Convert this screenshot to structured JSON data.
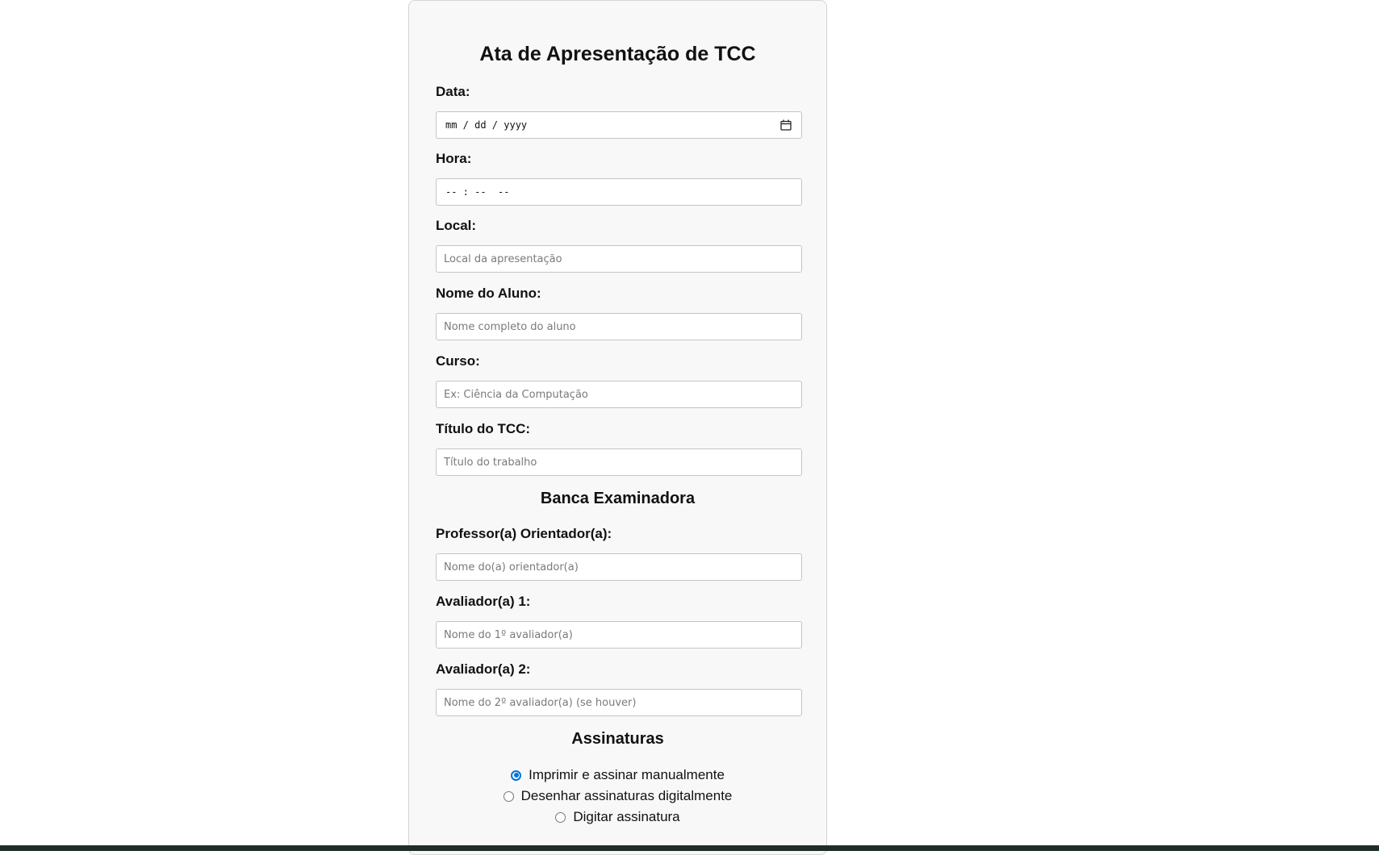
{
  "form": {
    "title": "Ata de Apresentação de TCC",
    "data": {
      "label": "Data:",
      "display": "mm / dd / yyyy"
    },
    "hora": {
      "label": "Hora:",
      "display": "-- : --  --"
    },
    "local": {
      "label": "Local:",
      "placeholder": "Local da apresentação"
    },
    "aluno": {
      "label": "Nome do Aluno:",
      "placeholder": "Nome completo do aluno"
    },
    "curso": {
      "label": "Curso:",
      "placeholder": "Ex: Ciência da Computação"
    },
    "titulo": {
      "label": "Título do TCC:",
      "placeholder": "Título do trabalho"
    }
  },
  "banca": {
    "heading": "Banca Examinadora",
    "orientador": {
      "label": "Professor(a) Orientador(a):",
      "placeholder": "Nome do(a) orientador(a)"
    },
    "avaliador1": {
      "label": "Avaliador(a) 1:",
      "placeholder": "Nome do 1º avaliador(a)"
    },
    "avaliador2": {
      "label": "Avaliador(a) 2:",
      "placeholder": "Nome do 2º avaliador(a) (se houver)"
    }
  },
  "assinaturas": {
    "heading": "Assinaturas",
    "options": [
      {
        "label": "Imprimir e assinar manualmente",
        "checked": true
      },
      {
        "label": "Desenhar assinaturas digitalmente",
        "checked": false
      },
      {
        "label": "Digitar assinatura",
        "checked": false
      }
    ]
  },
  "colors": {
    "card_background": "#f8f8f8",
    "radio_accent": "#0075d9",
    "bottom_bar": "#1c2e2a"
  },
  "icons": {
    "date_picker": "calendar-icon"
  }
}
